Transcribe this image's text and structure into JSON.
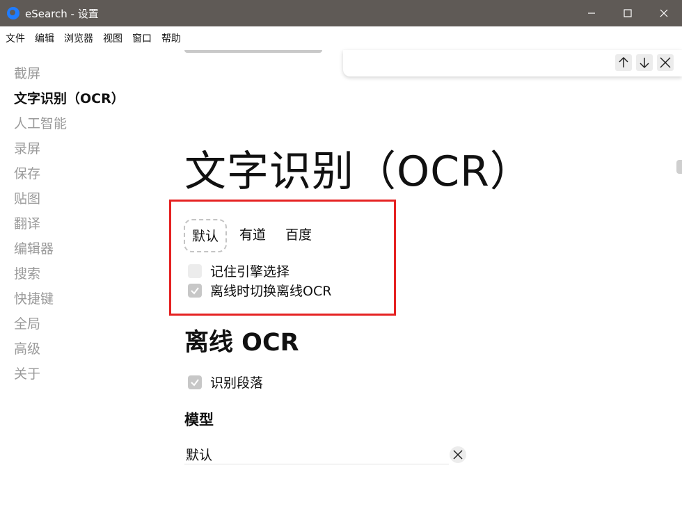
{
  "window": {
    "title": "eSearch - 设置",
    "minimize_icon": "minimize-icon",
    "maximize_icon": "maximize-icon",
    "close_icon": "close-icon"
  },
  "menubar": {
    "items": [
      "文件",
      "编辑",
      "浏览器",
      "视图",
      "窗口",
      "帮助"
    ]
  },
  "sidebar": {
    "items": [
      {
        "label": "截屏",
        "active": false
      },
      {
        "label": "文字识别（OCR）",
        "active": true
      },
      {
        "label": "人工智能",
        "active": false
      },
      {
        "label": "录屏",
        "active": false
      },
      {
        "label": "保存",
        "active": false
      },
      {
        "label": "贴图",
        "active": false
      },
      {
        "label": "翻译",
        "active": false
      },
      {
        "label": "编辑器",
        "active": false
      },
      {
        "label": "搜索",
        "active": false
      },
      {
        "label": "快捷键",
        "active": false
      },
      {
        "label": "全局",
        "active": false
      },
      {
        "label": "高级",
        "active": false
      },
      {
        "label": "关于",
        "active": false
      }
    ]
  },
  "findbar": {
    "up_icon": "arrow-up-icon",
    "down_icon": "arrow-down-icon",
    "close_icon": "close-icon"
  },
  "main": {
    "title": "文字识别（OCR）",
    "engine_tabs": [
      {
        "label": "默认",
        "selected": true
      },
      {
        "label": "有道",
        "selected": false
      },
      {
        "label": "百度",
        "selected": false
      }
    ],
    "remember_engine": {
      "label": "记住引擎选择",
      "checked": false
    },
    "offline_switch": {
      "label": "离线时切换离线OCR",
      "checked": true
    },
    "offline_section": {
      "heading": "离线 OCR",
      "paragraph": {
        "label": "识别段落",
        "checked": true
      },
      "model_heading": "模型",
      "model_value": "默认"
    }
  },
  "colors": {
    "titlebar": "#5f5a56",
    "highlight": "#e52222",
    "inactive_text": "#9a9a9a",
    "logo": "#1f7cff"
  }
}
